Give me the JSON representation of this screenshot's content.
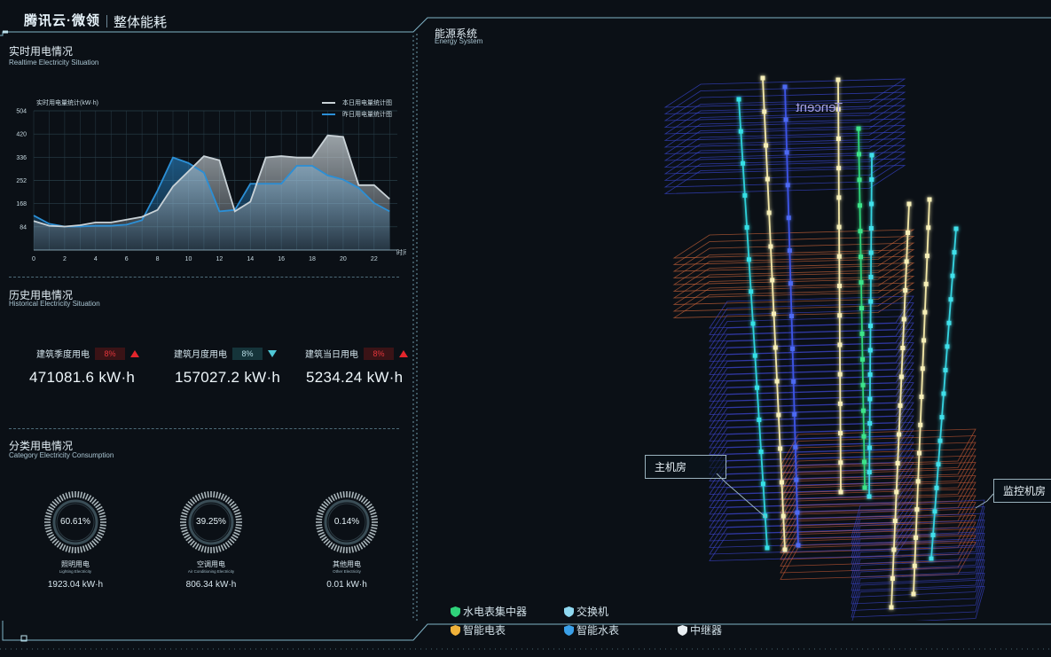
{
  "header": {
    "logo": "腾讯云·微领",
    "title": "整体能耗"
  },
  "realtime": {
    "title": "实时用电情况",
    "subtitle": "Realtime Electricity Situation",
    "chart_data": {
      "type": "area",
      "ylabel": "实时用电量统计(kW·h)",
      "xlabel": "时间",
      "ylim": [
        0,
        504
      ],
      "yticks": [
        84,
        168,
        252,
        336,
        420,
        504
      ],
      "xticks": [
        0,
        2,
        4,
        6,
        8,
        10,
        12,
        14,
        16,
        18,
        20,
        22
      ],
      "x": [
        0,
        1,
        2,
        3,
        4,
        5,
        6,
        7,
        8,
        9,
        10,
        11,
        12,
        13,
        14,
        15,
        16,
        17,
        18,
        19,
        20,
        21,
        22,
        23
      ],
      "series": [
        {
          "name": "本日用电量统计图",
          "color": "#c9d2d7",
          "values": [
            105,
            88,
            85,
            90,
            100,
            100,
            110,
            120,
            145,
            230,
            285,
            340,
            325,
            140,
            175,
            335,
            340,
            335,
            335,
            415,
            410,
            235,
            235,
            185
          ]
        },
        {
          "name": "昨日用电量统计图",
          "color": "#2b8fd6",
          "values": [
            125,
            95,
            85,
            85,
            88,
            88,
            92,
            108,
            215,
            335,
            315,
            280,
            140,
            145,
            240,
            240,
            240,
            305,
            305,
            270,
            255,
            225,
            170,
            140
          ]
        }
      ]
    }
  },
  "history": {
    "title": "历史用电情况",
    "subtitle": "Historical Electricity Situation",
    "stats": [
      {
        "label": "建筑季度用电",
        "pct": "8%",
        "trend": "up",
        "value": "471081.6 kW·h"
      },
      {
        "label": "建筑月度用电",
        "pct": "8%",
        "trend": "down",
        "value": "157027.2 kW·h"
      },
      {
        "label": "建筑当日用电",
        "pct": "8%",
        "trend": "up",
        "value": "5234.24 kW·h"
      }
    ]
  },
  "category": {
    "title": "分类用电情况",
    "subtitle": "Category Electricity Consumption",
    "items": [
      {
        "pct": "60.61%",
        "fraction": 0.6061,
        "name": "照明用电",
        "en": "Lighting Electricity",
        "value": "1923.04 kW·h"
      },
      {
        "pct": "39.25%",
        "fraction": 0.3925,
        "name": "空调用电",
        "en": "Air Conditioning Electricity",
        "value": "806.34 kW·h"
      },
      {
        "pct": "0.14%",
        "fraction": 0.0014,
        "name": "其他用电",
        "en": "Other Electricity",
        "value": "0.01 kW·h"
      }
    ]
  },
  "energy": {
    "title": "能源系统",
    "subtitle": "Energy System",
    "callout_left": "主机房",
    "callout_right": "监控机房",
    "legend": [
      {
        "label": "水电表集中器",
        "color": "#2fd37a",
        "icon": "shield-icon"
      },
      {
        "label": "交换机",
        "color": "#8fd8f0",
        "icon": "shield-icon"
      },
      {
        "label": "智能电表",
        "color": "#f0b23a",
        "icon": "shield-icon"
      },
      {
        "label": "智能水表",
        "color": "#3aa0e8",
        "icon": "shield-icon"
      },
      {
        "label": "中继器",
        "color": "#e8eef2",
        "icon": "shield-icon"
      }
    ]
  }
}
